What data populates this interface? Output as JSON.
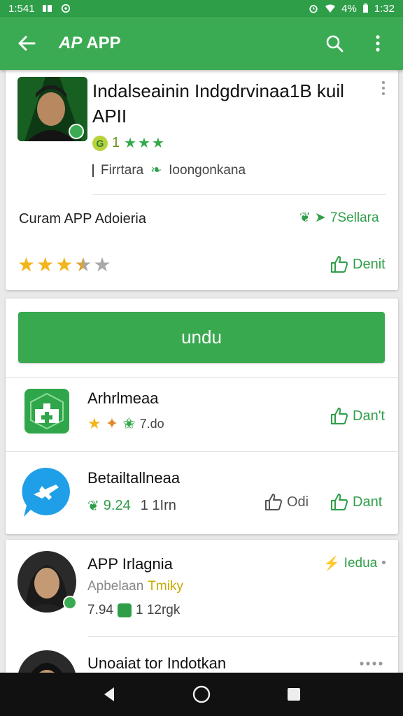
{
  "status_bar": {
    "time": "1:541",
    "battery": "4%",
    "clock_right": "1:32"
  },
  "app_bar": {
    "title": "APP",
    "logo_text": "AP"
  },
  "main_app": {
    "title": "Indalseainin Indgdrvinaa1B kuil APII",
    "badge_text": "1",
    "developer": "Firrtara",
    "developer_alt": "Ioongonkana",
    "subtitle": "Curam APP Adoieria",
    "tag": "7Sellara",
    "rating_stars": 3.5,
    "like_label": "Denit"
  },
  "install": {
    "label": "undu"
  },
  "related": [
    {
      "title": "Arhrlmeaa",
      "meta": "7.do",
      "like_label": "Dan't"
    },
    {
      "title": "Betailtallneaa",
      "meta_price": "9.24",
      "meta_size": "1 1Irn",
      "share_label": "Odi",
      "like_label": "Dant"
    }
  ],
  "reviews": [
    {
      "name": "APP Irlagnia",
      "sub": "Apbelaan",
      "sub_highlight": "Tmiky",
      "score": "7.94",
      "meta": "1 12rgk",
      "tag": "Iedua"
    },
    {
      "name": "Unoaiat tor Indotkan"
    }
  ],
  "colors": {
    "primary": "#3aab52",
    "status": "#2e9e48",
    "star": "#f3b51c"
  }
}
